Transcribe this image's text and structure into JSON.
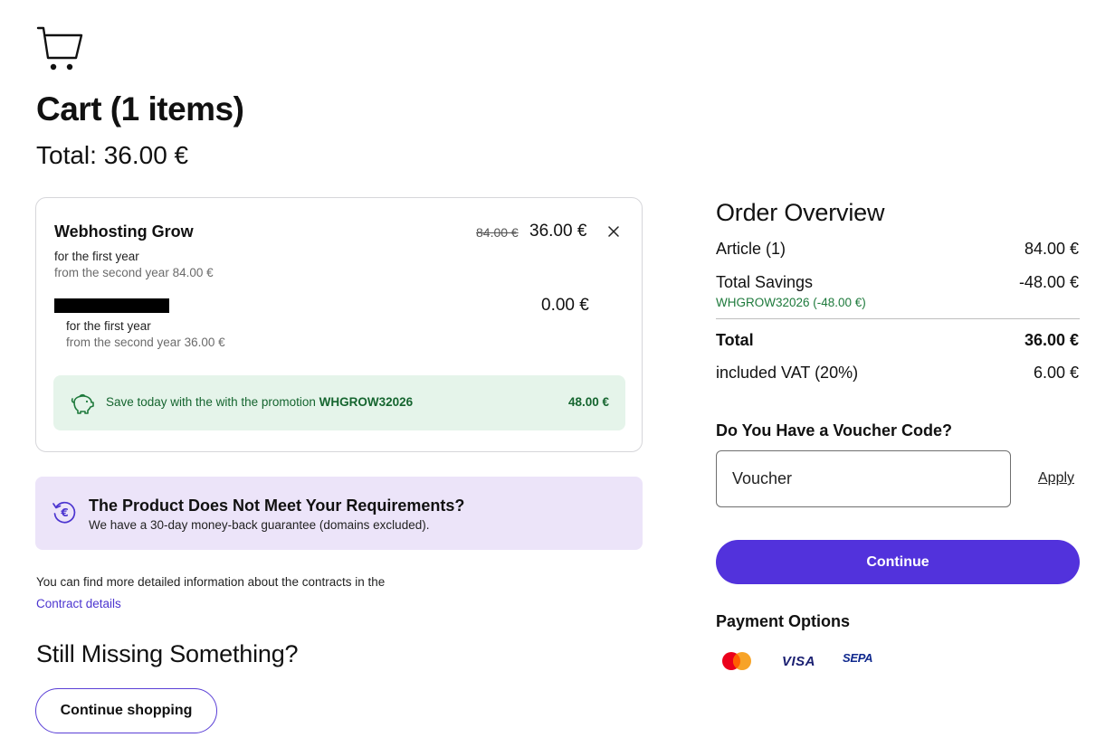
{
  "header": {
    "title": "Cart (1 items)",
    "total": "Total: 36.00 €"
  },
  "item": {
    "name": "Webhosting Grow",
    "old_price": "84.00 €",
    "price": "36.00 €",
    "first_year": "for the first year",
    "second_year": "from the second year 84.00 €",
    "sub": {
      "price": "0.00 €",
      "first_year": "for the first year",
      "second_year": "from the second year 36.00 €"
    },
    "promo": {
      "text": "Save today with the with the promotion",
      "code": "WHGROW32026",
      "amount": "48.00 €"
    }
  },
  "guarantee": {
    "title": "The Product Does Not Meet Your Requirements?",
    "subtitle": "We have a 30-day money-back guarantee (domains excluded)."
  },
  "contracts": {
    "info": "You can find more detailed information about the contracts in the",
    "link": "Contract details"
  },
  "missing": {
    "title": "Still Missing Something?",
    "button": "Continue shopping"
  },
  "overview": {
    "title": "Order Overview",
    "article_label": "Article (1)",
    "article_value": "84.00 €",
    "savings_label": "Total Savings",
    "savings_value": "-48.00 €",
    "savings_code": "WHGROW32026 (-48.00 €)",
    "total_label": "Total",
    "total_value": "36.00 €",
    "vat_label": "included VAT (20%)",
    "vat_value": "6.00 €"
  },
  "voucher": {
    "title": "Do You Have a Voucher Code?",
    "placeholder": "Voucher",
    "apply": "Apply"
  },
  "checkout": {
    "continue": "Continue"
  },
  "payment": {
    "title": "Payment Options",
    "methods": [
      "mastercard-icon",
      "visa-icon",
      "sepa-icon"
    ],
    "visa_text": "VISA",
    "sepa_text": "SEPA"
  },
  "colors": {
    "accent": "#5232dc",
    "promo_bg": "#e5f4ea",
    "promo_text": "#15652f",
    "guarantee_bg": "#ece4f9",
    "link": "#4c35d0"
  }
}
